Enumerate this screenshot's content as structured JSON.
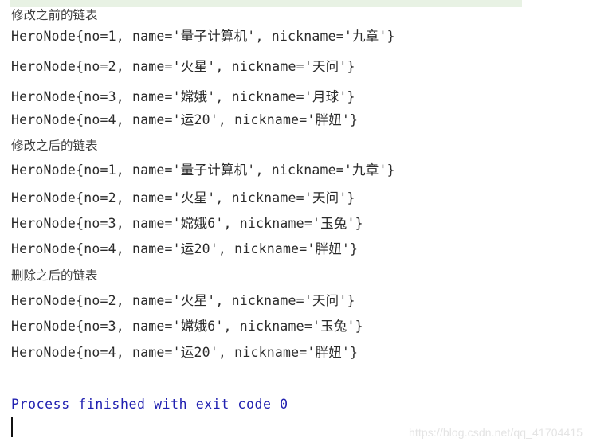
{
  "window": {
    "title": "Run console output",
    "background_color": "#ffffff",
    "run_band_color": "#e8f2e4",
    "text_color": "#2b2b2b",
    "exit_code_color": "#2020b0",
    "watermark_color": "#e4e4e4"
  },
  "console": {
    "sections": [
      {
        "heading": "修改之前的链表",
        "lines": [
          "HeroNode{no=1, name='量子计算机', nickname='九章'}",
          "HeroNode{no=2, name='火星', nickname='天问'}",
          "HeroNode{no=3, name='嫦娥', nickname='月球'}",
          "HeroNode{no=4, name='运20', nickname='胖妞'}"
        ]
      },
      {
        "heading": "修改之后的链表",
        "lines": [
          "HeroNode{no=1, name='量子计算机', nickname='九章'}",
          "HeroNode{no=2, name='火星', nickname='天问'}",
          "HeroNode{no=3, name='嫦娥6', nickname='玉兔'}",
          "HeroNode{no=4, name='运20', nickname='胖妞'}"
        ]
      },
      {
        "heading": "删除之后的链表",
        "lines": [
          "HeroNode{no=2, name='火星', nickname='天问'}",
          "HeroNode{no=3, name='嫦娥6', nickname='玉兔'}",
          "HeroNode{no=4, name='运20', nickname='胖妞'}"
        ]
      }
    ],
    "exit_message": "Process finished with exit code 0"
  },
  "watermark": {
    "text": "https://blog.csdn.net/qq_41704415"
  }
}
